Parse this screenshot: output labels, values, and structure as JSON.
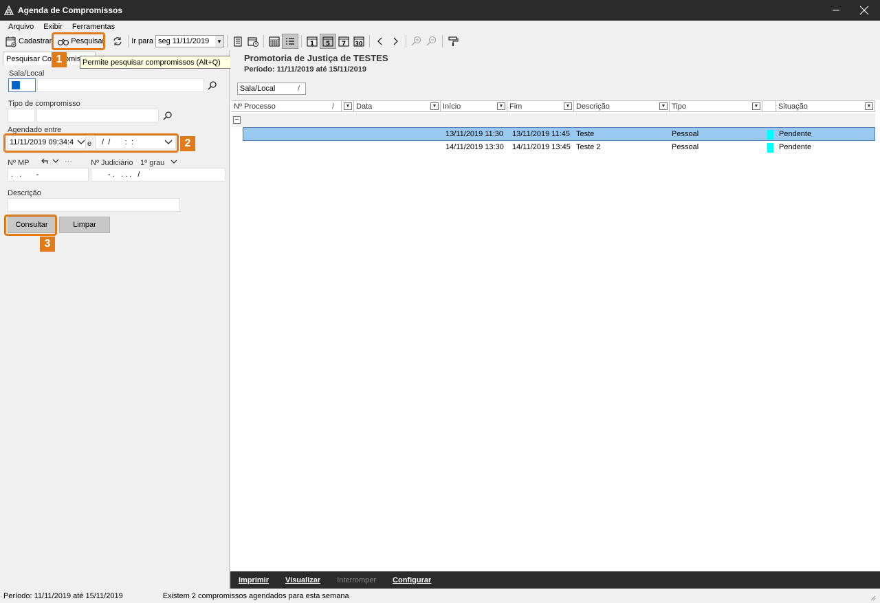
{
  "window": {
    "title": "Agenda de Compromissos"
  },
  "menu": [
    "Arquivo",
    "Exibir",
    "Ferramentas"
  ],
  "toolbar": {
    "cadastrar": "Cadastrar",
    "pesquisar": "Pesquisar",
    "ir_para": "Ir para",
    "date_value": "seg 11/11/2019"
  },
  "tooltip": "Permite pesquisar compromissos (Alt+Q)",
  "search_panel": {
    "tab_label": "Pesquisar Compromissos",
    "sala_local_label": "Sala/Local",
    "tipo_label": "Tipo de compromisso",
    "agendado_label": "Agendado entre",
    "date_from": "11/11/2019 09:34:4",
    "between": "e",
    "date_to": " /  /       :  :",
    "nmp_label": "Nº MP",
    "nmp_value": ".   .       -",
    "nmp_more": "···",
    "judiciario_label": "Nº Judiciário",
    "grau": "1º grau",
    "judiciario_value": "- .   . . .   /",
    "descricao_label": "Descrição",
    "consultar": "Consultar",
    "limpar": "Limpar"
  },
  "callouts": [
    "1",
    "2",
    "3"
  ],
  "results": {
    "title": "Promotoria de Justiça de TESTES",
    "period": "Período: 11/11/2019 até 15/11/2019",
    "group_chip": "Sala/Local",
    "group_sort": "/",
    "columns": [
      "Nº Processo",
      "Data",
      "Início",
      "Fim",
      "Descrição",
      "Tipo",
      "",
      "Situação"
    ],
    "sort_marker": "/",
    "rows": [
      {
        "inicio": "13/11/2019 11:30",
        "fim": "13/11/2019 11:45",
        "descricao": "Teste",
        "tipo": "Pessoal",
        "situacao": "Pendente"
      },
      {
        "inicio": "14/11/2019 13:30",
        "fim": "14/11/2019 13:45",
        "descricao": "Teste 2",
        "tipo": "Pessoal",
        "situacao": "Pendente"
      }
    ]
  },
  "bottom_actions": {
    "imprimir": "Imprimir",
    "visualizar": "Visualizar",
    "interromper": "Interromper",
    "configurar": "Configurar"
  },
  "status": {
    "period": "Período: 11/11/2019 até 15/11/2019",
    "message": "Existem 2 compromissos agendados para esta semana"
  },
  "colors": {
    "accent": "#e07b1a",
    "selected_row": "#99c9ef",
    "status_pendente": "#00ffff",
    "titlebar": "#2b2b2b"
  }
}
